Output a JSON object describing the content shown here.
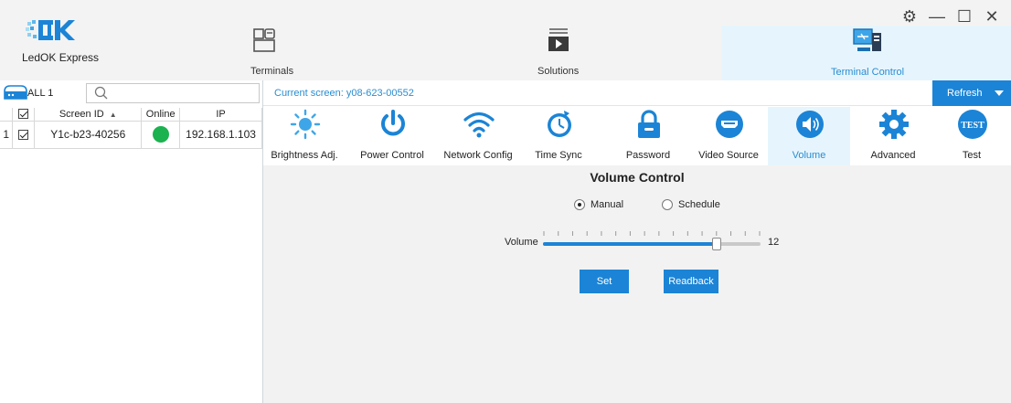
{
  "app": {
    "name": "LedOK Express"
  },
  "window_controls": {
    "settings": "⚙",
    "minimize": "—",
    "maximize": "☐",
    "close": "✕"
  },
  "nav": {
    "terminals": "Terminals",
    "solutions": "Solutions",
    "terminal_control": "Terminal Control"
  },
  "left": {
    "group_label": "ALL 1",
    "search": {
      "value": "",
      "placeholder": ""
    },
    "columns": {
      "screen_id": "Screen ID",
      "online": "Online",
      "ip": "IP"
    },
    "rows": [
      {
        "index": "1",
        "screen_id": "Y1c-b23-40256",
        "online": true,
        "ip": "192.168.1.103"
      }
    ]
  },
  "toolbar": {
    "current_screen": "Current screen: y08-623-00552",
    "refresh": "Refresh"
  },
  "functions": [
    {
      "label": "Brightness Adj.",
      "icon": "brightness-icon"
    },
    {
      "label": "Power Control",
      "icon": "power-icon"
    },
    {
      "label": "Network Config",
      "icon": "wifi-icon"
    },
    {
      "label": "Time Sync",
      "icon": "clock-sync-icon"
    },
    {
      "label": "Password",
      "icon": "lock-icon"
    },
    {
      "label": "Video Source",
      "icon": "hdmi-icon"
    },
    {
      "label": "Volume",
      "icon": "speaker-icon",
      "active": true
    },
    {
      "label": "Advanced",
      "icon": "gear-icon"
    },
    {
      "label": "Test",
      "icon": "test-badge-icon",
      "badge_text": "TEST"
    }
  ],
  "volume_control": {
    "title": "Volume Control",
    "mode_manual": "Manual",
    "mode_schedule": "Schedule",
    "selected_mode": "manual",
    "volume_label": "Volume",
    "volume_value": "12",
    "volume_level": 12,
    "volume_max": 15,
    "set": "Set",
    "readback": "Readback"
  },
  "colors": {
    "accent": "#1b84d6",
    "active_tab_bg": "#e6f5fd",
    "online": "#1bb24f",
    "icon_blue": "#1b84d6",
    "sun_blue": "#3ea6e8"
  }
}
